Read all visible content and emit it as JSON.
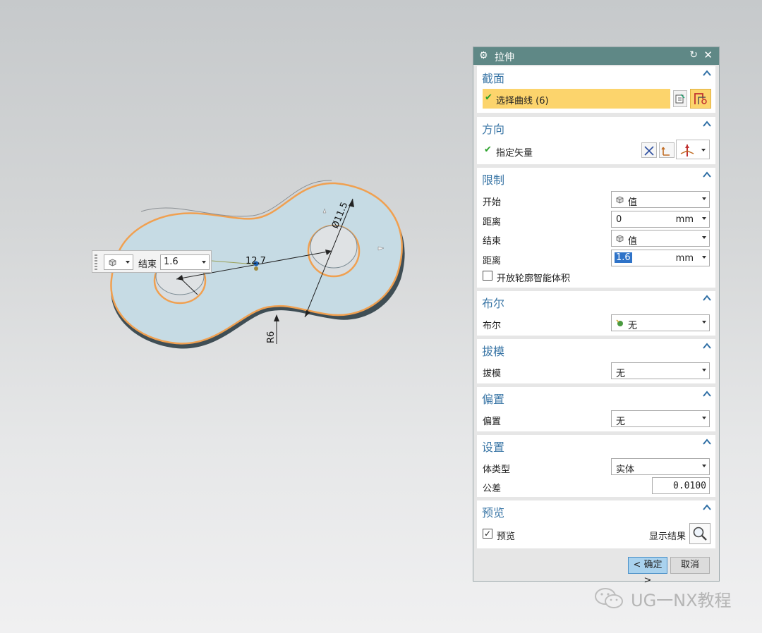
{
  "viewport": {
    "dim_diameter": "Ø11.5",
    "dim_length": "12.7",
    "dim_radius": "R6"
  },
  "float_widget": {
    "end_label": "结束",
    "end_value": "1.6"
  },
  "dialog": {
    "title": "拉伸",
    "section": {
      "title": "截面",
      "select_curve": "选择曲线 (6)"
    },
    "direction": {
      "title": "方向",
      "specify_vector": "指定矢量"
    },
    "limits": {
      "title": "限制",
      "start_label": "开始",
      "start_value": "值",
      "distance1_label": "距离",
      "distance1_value": "0",
      "distance1_unit": "mm",
      "end_label": "结束",
      "end_value": "值",
      "distance2_label": "距离",
      "distance2_value": "1.6",
      "distance2_unit": "mm",
      "open_profile": "开放轮廓智能体积"
    },
    "boolean": {
      "title": "布尔",
      "label": "布尔",
      "value": "无"
    },
    "draft": {
      "title": "拔模",
      "label": "拔模",
      "value": "无"
    },
    "offset": {
      "title": "偏置",
      "label": "偏置",
      "value": "无"
    },
    "settings": {
      "title": "设置",
      "body_type_label": "体类型",
      "body_type_value": "实体",
      "tolerance_label": "公差",
      "tolerance_value": "0.0100"
    },
    "preview": {
      "title": "预览",
      "preview_label": "预览",
      "show_result": "显示结果"
    },
    "ok_button": "< 确定 >",
    "cancel_button": "取消"
  },
  "watermark": "UG一NX教程",
  "colors": {
    "titlebar": "#5f8886",
    "section_title": "#3a76a6",
    "selection_highlight": "#fcd46c",
    "part_fill": "#c6dbe4",
    "edge_orange": "#f0a050"
  }
}
